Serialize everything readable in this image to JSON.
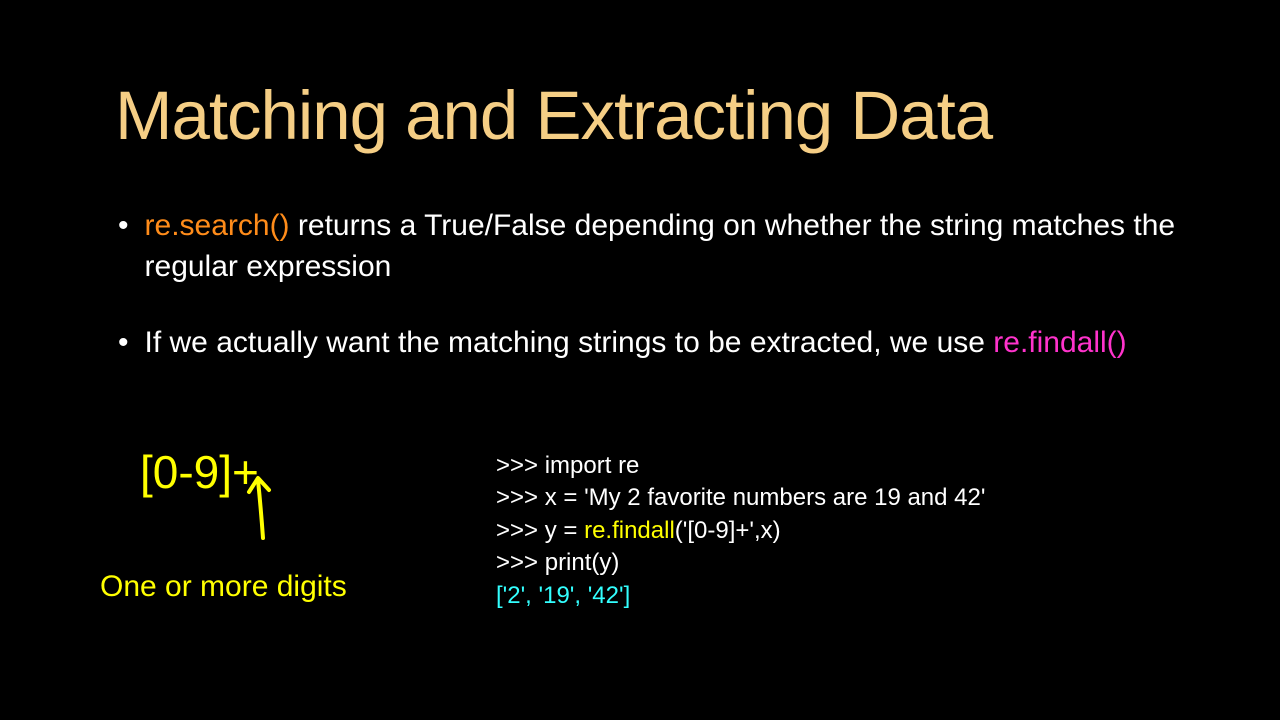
{
  "title": "Matching and Extracting Data",
  "bullet1": {
    "code": "re.search()",
    "rest": " returns a True/False depending on whether the string matches  the regular expression"
  },
  "bullet2": {
    "pre": "If we actually want the matching strings to be extracted, we use ",
    "code": "re.findall()"
  },
  "regex": {
    "pattern": "[0-9]+",
    "label": "One or more digits"
  },
  "code": {
    "l1a": ">>> import re",
    "l2a": ">>> x = 'My 2 favorite numbers are 19 and 42'",
    "l3a": ">>> y = ",
    "l3b": "re.findall",
    "l3c": "('[0-9]+',x)",
    "l4a": ">>> print(y)",
    "l5a": "['2', '19', '42']"
  }
}
